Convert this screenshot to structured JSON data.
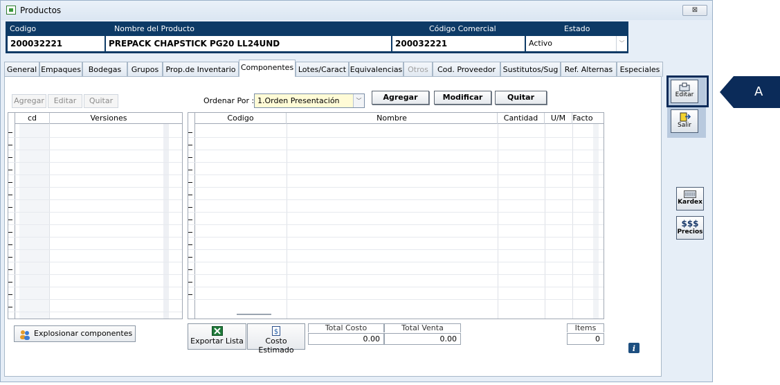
{
  "window": {
    "title": "Productos",
    "close_symbol": "⊠"
  },
  "header": {
    "codigo_label": "Codigo",
    "nombre_label": "Nombre del Producto",
    "comercial_label": "Código Comercial",
    "estado_label": "Estado",
    "codigo_value": "200032221",
    "nombre_value": "PREPACK CHAPSTICK PG20 LL24UND",
    "comercial_value": "200032221",
    "estado_value": "Activo"
  },
  "tabs": [
    "General",
    "Empaques",
    "Bodegas",
    "Grupos",
    "Prop.de Inventario",
    "Componentes",
    "Lotes/Caract",
    "Equivalencias",
    "Otros",
    "Cod. Proveedor",
    "Sustitutos/Sug",
    "Ref. Alternas",
    "Especiales"
  ],
  "left_toolbar": {
    "agregar": "Agregar",
    "editar": "Editar",
    "quitar": "Quitar"
  },
  "ordenar": {
    "label": "Ordenar Por :",
    "value": "1.Orden Presentación"
  },
  "main_toolbar": {
    "agregar": "Agregar",
    "modificar": "Modificar",
    "quitar": "Quitar"
  },
  "versions_grid": {
    "col_cd": "cd",
    "col_versiones": "Versiones"
  },
  "components_grid": {
    "col_codigo": "Codigo",
    "col_nombre": "Nombre",
    "col_cantidad": "Cantidad",
    "col_um": "U/M",
    "col_factor": "Facto"
  },
  "bottom": {
    "explosionar": "Explosionar componentes",
    "exportar": "Exportar Lista",
    "costo_estimado": "Costo Estimado",
    "total_costo_label": "Total Costo",
    "total_costo_value": "0.00",
    "total_venta_label": "Total Venta",
    "total_venta_value": "0.00",
    "items_label": "Items",
    "items_value": "0"
  },
  "sidebar": {
    "editar": "Editar",
    "salir": "Salir",
    "kardex": "Kardex",
    "precios_sym": "$$$",
    "precios": "Precios"
  },
  "callout": {
    "label": "A"
  },
  "colors": {
    "header_bg": "#0d3a66",
    "select_bg": "#fffbd6",
    "callout_bg": "#0b2b59"
  }
}
